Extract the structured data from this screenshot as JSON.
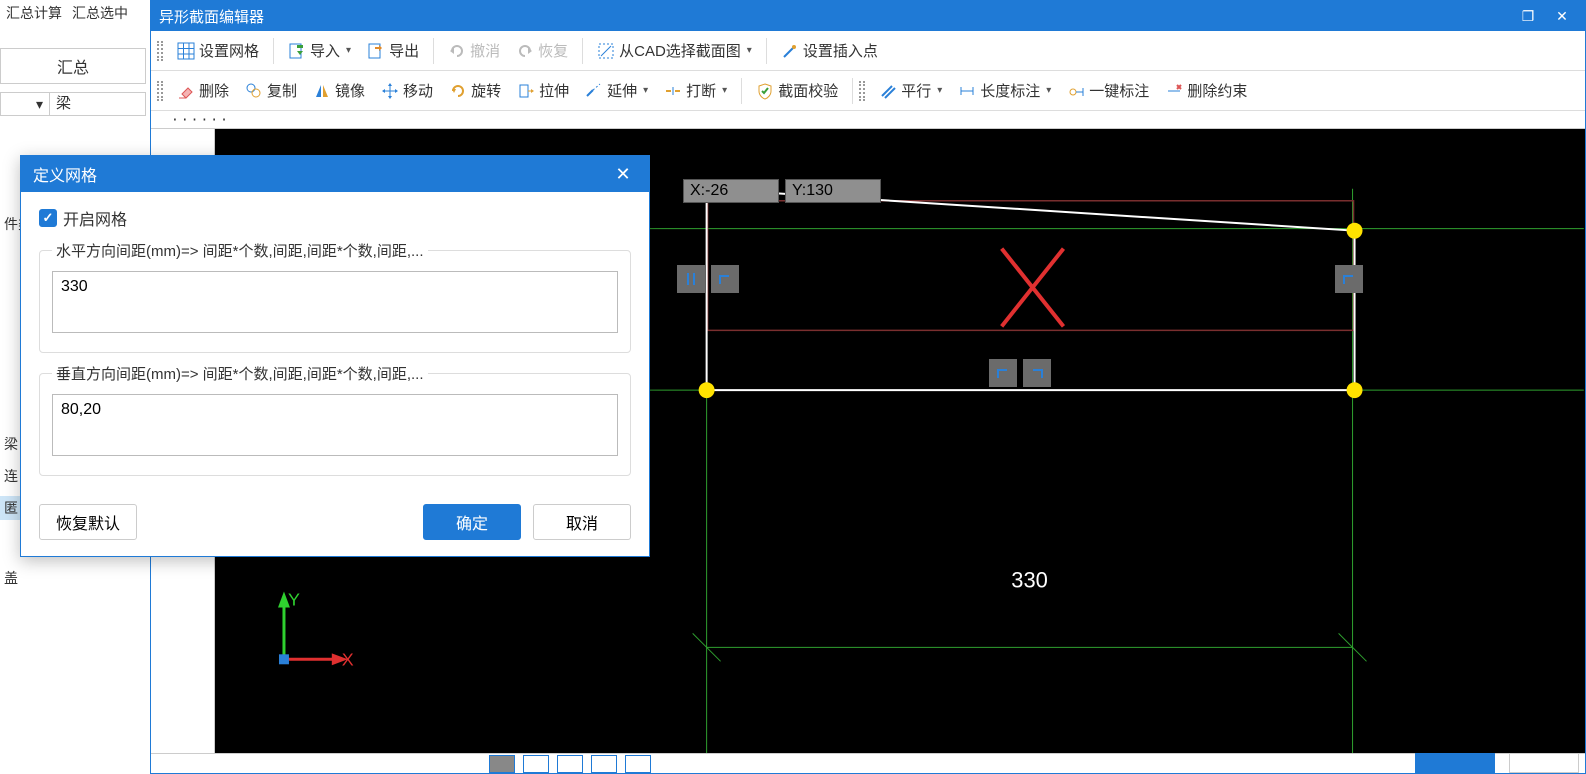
{
  "bg": {
    "menu1": "汇总计算",
    "menu2": "汇总选中",
    "tab": "汇总",
    "dropdown_mark": "▾",
    "dropdown_value": "梁",
    "left_items": [
      "件类",
      "",
      "",
      "",
      "梁",
      "连",
      "匿",
      "",
      "盖"
    ]
  },
  "editor": {
    "title": "异形截面编辑器",
    "toolbar1": {
      "set_grid": "设置网格",
      "import": "导入",
      "export": "导出",
      "undo": "撤消",
      "redo": "恢复",
      "from_cad": "从CAD选择截面图",
      "insert_point": "设置插入点"
    },
    "toolbar2": {
      "delete": "删除",
      "copy": "复制",
      "mirror": "镜像",
      "move": "移动",
      "rotate": "旋转",
      "stretch": "拉伸",
      "extend": "延伸",
      "break": "打断",
      "validate": "截面校验",
      "parallel": "平行",
      "dim": "长度标注",
      "auto_dim": "一键标注",
      "del_constraint": "删除约束"
    },
    "ruler_dots": "······",
    "coord_x": "X:-26",
    "coord_y": "Y:130",
    "dim_330": "330",
    "axis_x": "X",
    "axis_y": "Y"
  },
  "modal": {
    "title": "定义网格",
    "enable": "开启网格",
    "h_legend": "水平方向间距(mm)=> 间距*个数,间距,间距*个数,间距,...",
    "h_value": "330",
    "v_legend": "垂直方向间距(mm)=> 间距*个数,间距,间距*个数,间距,...",
    "v_value": "80,20",
    "restore": "恢复默认",
    "ok": "确定",
    "cancel": "取消"
  }
}
